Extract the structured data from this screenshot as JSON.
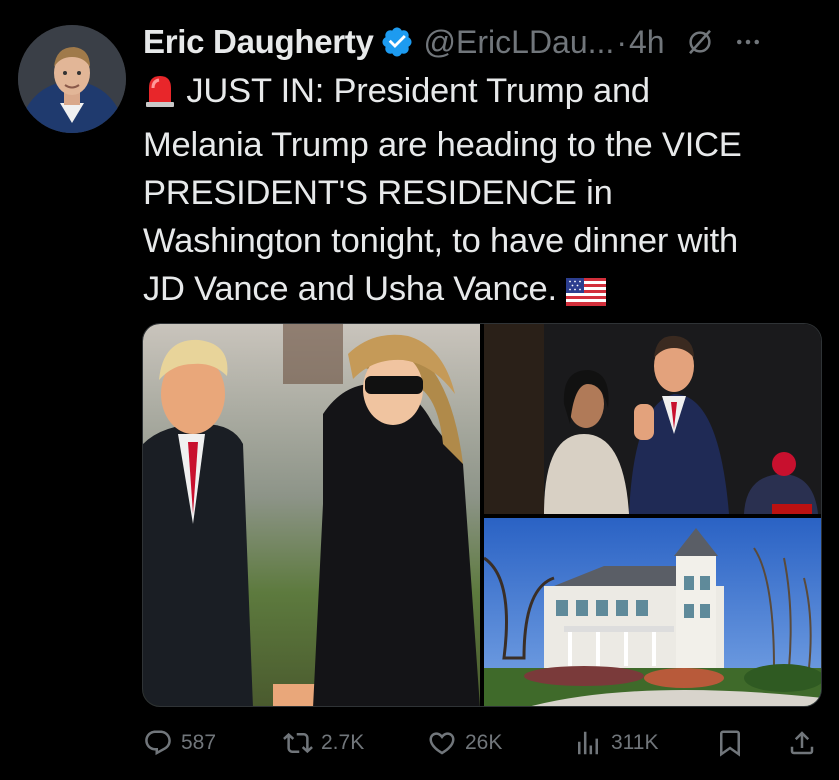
{
  "tweet": {
    "author_name": "Eric Daugherty",
    "handle": "@EricLDau...",
    "separator": "·",
    "time": "4h",
    "text_lines": [
      " JUST IN: President Trump and",
      "Melania Trump are heading to the VICE",
      "PRESIDENT'S RESIDENCE in",
      "Washington tonight, to have dinner with",
      "JD Vance and Usha Vance. "
    ],
    "lead_emoji": "rotating-light",
    "trailing_emoji": "us-flag"
  },
  "media": [
    {
      "name": "trump-melania-photo",
      "description_visible": false
    },
    {
      "name": "vance-couple-photo",
      "description_visible": false
    },
    {
      "name": "vice-president-residence-photo",
      "description_visible": false
    }
  ],
  "actions": {
    "replies": "587",
    "reposts": "2.7K",
    "likes": "26K",
    "views": "311K"
  },
  "colors": {
    "background": "#000000",
    "text": "#e7e9ea",
    "secondary": "#71767b",
    "verified": "#1d9bf0"
  },
  "icons": [
    "verified-badge-icon",
    "grok-icon",
    "more-icon",
    "reply-icon",
    "repost-icon",
    "like-icon",
    "views-icon",
    "bookmark-icon",
    "share-icon"
  ]
}
